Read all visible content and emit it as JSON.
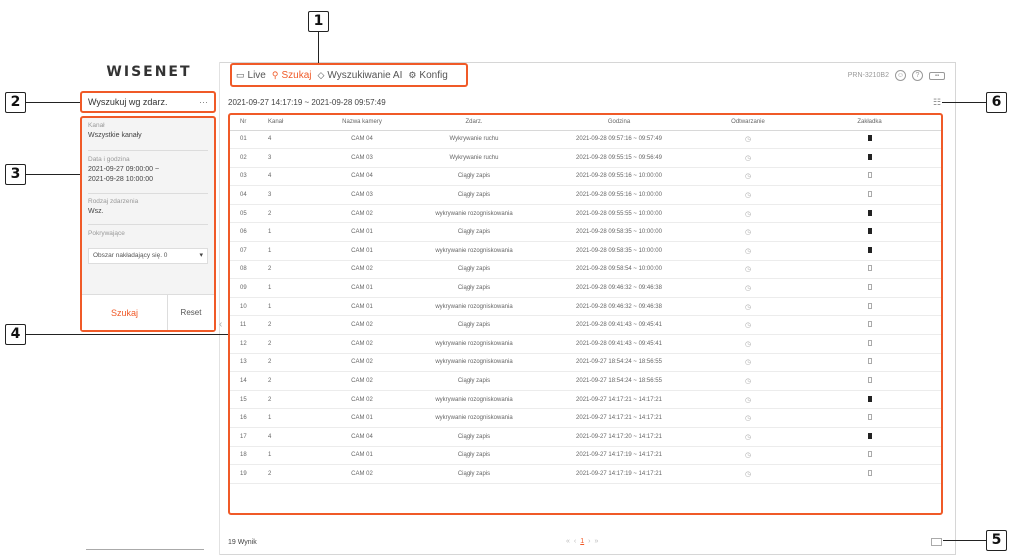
{
  "logo": "WISENET",
  "nav": [
    {
      "label": "Live",
      "icon": "monitor-icon",
      "active": false
    },
    {
      "label": "Szukaj",
      "icon": "search-icon",
      "active": true
    },
    {
      "label": "Wyszukiwanie AI",
      "icon": "ai-icon",
      "active": false
    },
    {
      "label": "Konfig",
      "icon": "gear-icon",
      "active": false
    }
  ],
  "topright": {
    "model": "PRN-3210B2",
    "icons": [
      "user-icon",
      "help-icon",
      "battery-icon"
    ]
  },
  "search_type": {
    "label": "Wyszukuj wg zdarz.",
    "more": "···"
  },
  "filters": {
    "channel": {
      "label": "Kanał",
      "value": "Wszystkie kanały"
    },
    "datetime": {
      "label": "Data i godzina",
      "value_line1": "2021-09-27 09:00:00 ~",
      "value_line2": "2021-09-28 10:00:00"
    },
    "event_type": {
      "label": "Rodzaj zdarzenia",
      "value": "Wsz."
    },
    "overlap": {
      "label": "Pokrywające",
      "value": "Obszar nakładający się. 0"
    }
  },
  "buttons": {
    "search": "Szukaj",
    "reset": "Reset"
  },
  "range": "2021-09-27 14:17:19 ~ 2021-09-28 09:57:49",
  "table": {
    "headers": [
      "Nr",
      "Kanał",
      "Nazwa kamery",
      "Zdarz.",
      "Godzina",
      "Odtwarzanie",
      "Zakładka"
    ],
    "rows": [
      [
        "01",
        "4",
        "CAM 04",
        "Wykrywanie ruchu",
        "2021-09-28 09:57:16 ~ 09:57:49",
        true
      ],
      [
        "02",
        "3",
        "CAM 03",
        "Wykrywanie ruchu",
        "2021-09-28 09:55:15 ~ 09:56:49",
        true
      ],
      [
        "03",
        "4",
        "CAM 04",
        "Ciągły zapis",
        "2021-09-28 09:55:16 ~ 10:00:00",
        false
      ],
      [
        "04",
        "3",
        "CAM 03",
        "Ciągły zapis",
        "2021-09-28 09:55:16 ~ 10:00:00",
        false
      ],
      [
        "05",
        "2",
        "CAM 02",
        "wykrywanie rozogniskowania",
        "2021-09-28 09:55:55 ~ 10:00:00",
        true
      ],
      [
        "06",
        "1",
        "CAM 01",
        "Ciągły zapis",
        "2021-09-28 09:58:35 ~ 10:00:00",
        true
      ],
      [
        "07",
        "1",
        "CAM 01",
        "wykrywanie rozogniskowania",
        "2021-09-28 09:58:35 ~ 10:00:00",
        true
      ],
      [
        "08",
        "2",
        "CAM 02",
        "Ciągły zapis",
        "2021-09-28 09:58:54 ~ 10:00:00",
        false
      ],
      [
        "09",
        "1",
        "CAM 01",
        "Ciągły zapis",
        "2021-09-28 09:46:32 ~ 09:46:38",
        false
      ],
      [
        "10",
        "1",
        "CAM 01",
        "wykrywanie rozogniskowania",
        "2021-09-28 09:46:32 ~ 09:46:38",
        false
      ],
      [
        "11",
        "2",
        "CAM 02",
        "Ciągły zapis",
        "2021-09-28 09:41:43 ~ 09:45:41",
        false
      ],
      [
        "12",
        "2",
        "CAM 02",
        "wykrywanie rozogniskowania",
        "2021-09-28 09:41:43 ~ 09:45:41",
        false
      ],
      [
        "13",
        "2",
        "CAM 02",
        "wykrywanie rozogniskowania",
        "2021-09-27 18:54:24 ~ 18:56:55",
        false
      ],
      [
        "14",
        "2",
        "CAM 02",
        "Ciągły zapis",
        "2021-09-27 18:54:24 ~ 18:56:55",
        false
      ],
      [
        "15",
        "2",
        "CAM 02",
        "wykrywanie rozogniskowania",
        "2021-09-27 14:17:21 ~ 14:17:21",
        true
      ],
      [
        "16",
        "1",
        "CAM 01",
        "wykrywanie rozogniskowania",
        "2021-09-27 14:17:21 ~ 14:17:21",
        false
      ],
      [
        "17",
        "4",
        "CAM 04",
        "Ciągły zapis",
        "2021-09-27 14:17:20 ~ 14:17:21",
        true
      ],
      [
        "18",
        "1",
        "CAM 01",
        "Ciągły zapis",
        "2021-09-27 14:17:19 ~ 14:17:21",
        false
      ],
      [
        "19",
        "2",
        "CAM 02",
        "Ciągły zapis",
        "2021-09-27 14:17:19 ~ 14:17:21",
        false
      ]
    ]
  },
  "results": "19 Wynik",
  "pager": {
    "prev": "‹",
    "first": "«",
    "page": "1",
    "next": "›",
    "last": "»"
  },
  "callouts": [
    "1",
    "2",
    "3",
    "4",
    "5",
    "6"
  ]
}
